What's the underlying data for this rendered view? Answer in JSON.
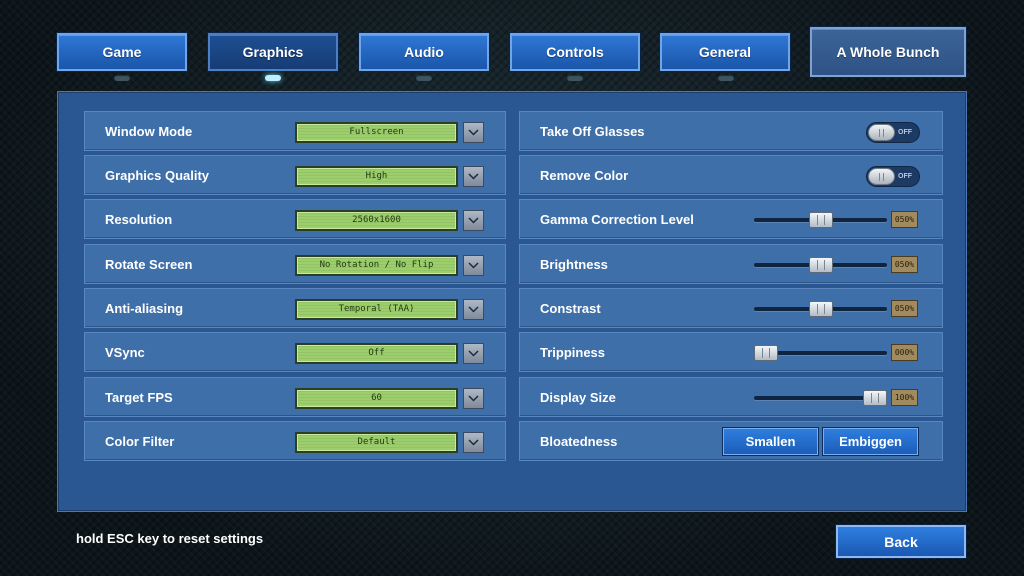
{
  "tabs": [
    {
      "label": "Game",
      "active": false
    },
    {
      "label": "Graphics",
      "active": true
    },
    {
      "label": "Audio",
      "active": false
    },
    {
      "label": "Controls",
      "active": false
    },
    {
      "label": "General",
      "active": false
    },
    {
      "label": "A Whole Bunch",
      "active": false
    }
  ],
  "left_settings": [
    {
      "label": "Window Mode",
      "value": "Fullscreen"
    },
    {
      "label": "Graphics Quality",
      "value": "High"
    },
    {
      "label": "Resolution",
      "value": "2560x1600"
    },
    {
      "label": "Rotate Screen",
      "value": "No Rotation / No Flip"
    },
    {
      "label": "Anti-aliasing",
      "value": "Temporal (TAA)"
    },
    {
      "label": "VSync",
      "value": "Off"
    },
    {
      "label": "Target FPS",
      "value": "60"
    },
    {
      "label": "Color Filter",
      "value": "Default"
    }
  ],
  "right_settings": {
    "take_off_glasses": {
      "label": "Take Off Glasses",
      "state": "OFF"
    },
    "remove_color": {
      "label": "Remove Color",
      "state": "OFF"
    },
    "gamma": {
      "label": "Gamma Correction Level",
      "value": 50,
      "display": "050%"
    },
    "brightness": {
      "label": "Brightness",
      "value": 50,
      "display": "050%"
    },
    "contrast": {
      "label": "Constrast",
      "value": 50,
      "display": "050%"
    },
    "trippiness": {
      "label": "Trippiness",
      "value": 0,
      "display": "000%"
    },
    "display_size": {
      "label": "Display Size",
      "value": 100,
      "display": "100%"
    },
    "bloatedness": {
      "label": "Bloatedness",
      "smallen": "Smallen",
      "embiggen": "Embiggen"
    }
  },
  "footer": {
    "hint": "hold ESC key to reset settings",
    "back_label": "Back"
  },
  "colors": {
    "panel": "#2a5791",
    "row": "#3f6fa9",
    "button": "#1f64c4",
    "lcd": "#9ccf6c",
    "value_box": "#a18a5e"
  }
}
